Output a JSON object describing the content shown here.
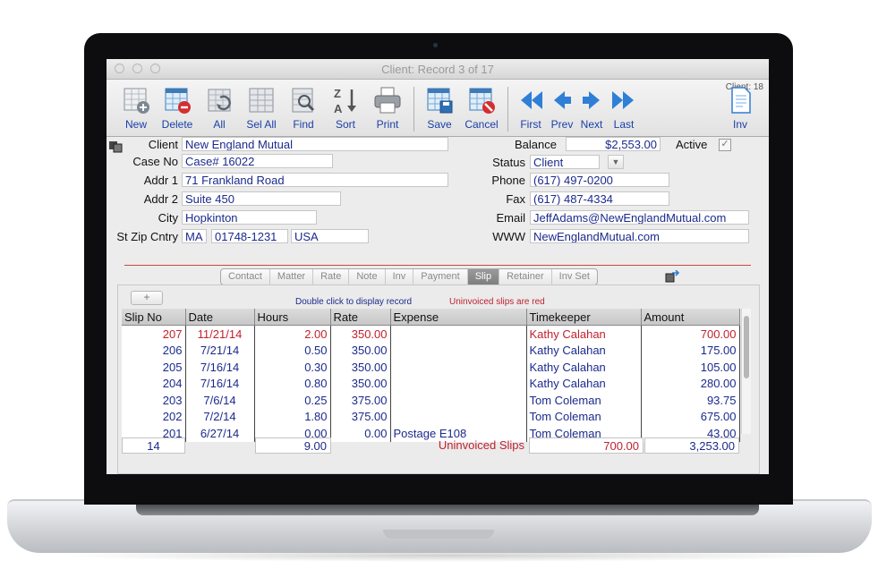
{
  "window": {
    "title": "Client: Record 3 of 17",
    "client_count": "Client: 18"
  },
  "toolbar": {
    "new": "New",
    "delete": "Delete",
    "all": "All",
    "sel_all": "Sel All",
    "find": "Find",
    "sort": "Sort",
    "print": "Print",
    "save": "Save",
    "cancel": "Cancel",
    "first": "First",
    "prev": "Prev",
    "next": "Next",
    "last": "Last",
    "inv": "Inv"
  },
  "form": {
    "client_label": "Client",
    "client": "New England Mutual",
    "case_label": "Case No",
    "case": "Case# 16022",
    "addr1_label": "Addr 1",
    "addr1": "71 Frankland Road",
    "addr2_label": "Addr 2",
    "addr2": "Suite 450",
    "city_label": "City",
    "city": "Hopkinton",
    "stzip_label": "St Zip Cntry",
    "state": "MA",
    "zip": "01748-1231",
    "country": "USA",
    "balance_label": "Balance",
    "balance": "$2,553.00",
    "active_label": "Active",
    "active_mark": "✓",
    "status_label": "Status",
    "status": "Client",
    "phone_label": "Phone",
    "phone": "(617) 497-0200",
    "fax_label": "Fax",
    "fax": "(617) 487-4334",
    "email_label": "Email",
    "email": "JeffAdams@NewEnglandMutual.com",
    "www_label": "WWW",
    "www": "NewEnglandMutual.com"
  },
  "tabs": [
    "Contact",
    "Matter",
    "Rate",
    "Note",
    "Inv",
    "Payment",
    "Slip",
    "Retainer",
    "Inv Set"
  ],
  "active_tab": "Slip",
  "panel": {
    "add_label": "+",
    "hint": "Double click to display record",
    "uninvoiced_hint": "Uninvoiced slips are red"
  },
  "slips": {
    "columns": [
      "Slip No",
      "Date",
      "Hours",
      "Rate",
      "Expense",
      "Timekeeper",
      "Amount"
    ],
    "rows": [
      {
        "slip": "207",
        "date": "11/21/14",
        "hours": "2.00",
        "rate": "350.00",
        "expense": "",
        "tk": "Kathy Calahan",
        "amount": "700.00",
        "uninvoiced": true
      },
      {
        "slip": "206",
        "date": "7/21/14",
        "hours": "0.50",
        "rate": "350.00",
        "expense": "",
        "tk": "Kathy Calahan",
        "amount": "175.00",
        "uninvoiced": false
      },
      {
        "slip": "205",
        "date": "7/16/14",
        "hours": "0.30",
        "rate": "350.00",
        "expense": "",
        "tk": "Kathy Calahan",
        "amount": "105.00",
        "uninvoiced": false
      },
      {
        "slip": "204",
        "date": "7/16/14",
        "hours": "0.80",
        "rate": "350.00",
        "expense": "",
        "tk": "Kathy Calahan",
        "amount": "280.00",
        "uninvoiced": false
      },
      {
        "slip": "203",
        "date": "7/6/14",
        "hours": "0.25",
        "rate": "375.00",
        "expense": "",
        "tk": "Tom Coleman",
        "amount": "93.75",
        "uninvoiced": false
      },
      {
        "slip": "202",
        "date": "7/2/14",
        "hours": "1.80",
        "rate": "375.00",
        "expense": "",
        "tk": "Tom Coleman",
        "amount": "675.00",
        "uninvoiced": false
      },
      {
        "slip": "201",
        "date": "6/27/14",
        "hours": "0.00",
        "rate": "0.00",
        "expense": "Postage  E108",
        "tk": "Tom Coleman",
        "amount": "43.00",
        "uninvoiced": false
      }
    ],
    "totals": {
      "count": "14",
      "hours": "9.00",
      "uninvoiced_label": "Uninvoiced Slips",
      "uninvoiced_amount": "700.00",
      "total_amount": "3,253.00"
    }
  },
  "colors": {
    "blue_text": "#1b2a8c",
    "red_text": "#c0222e",
    "toolbar_label": "#1a3fa8"
  }
}
